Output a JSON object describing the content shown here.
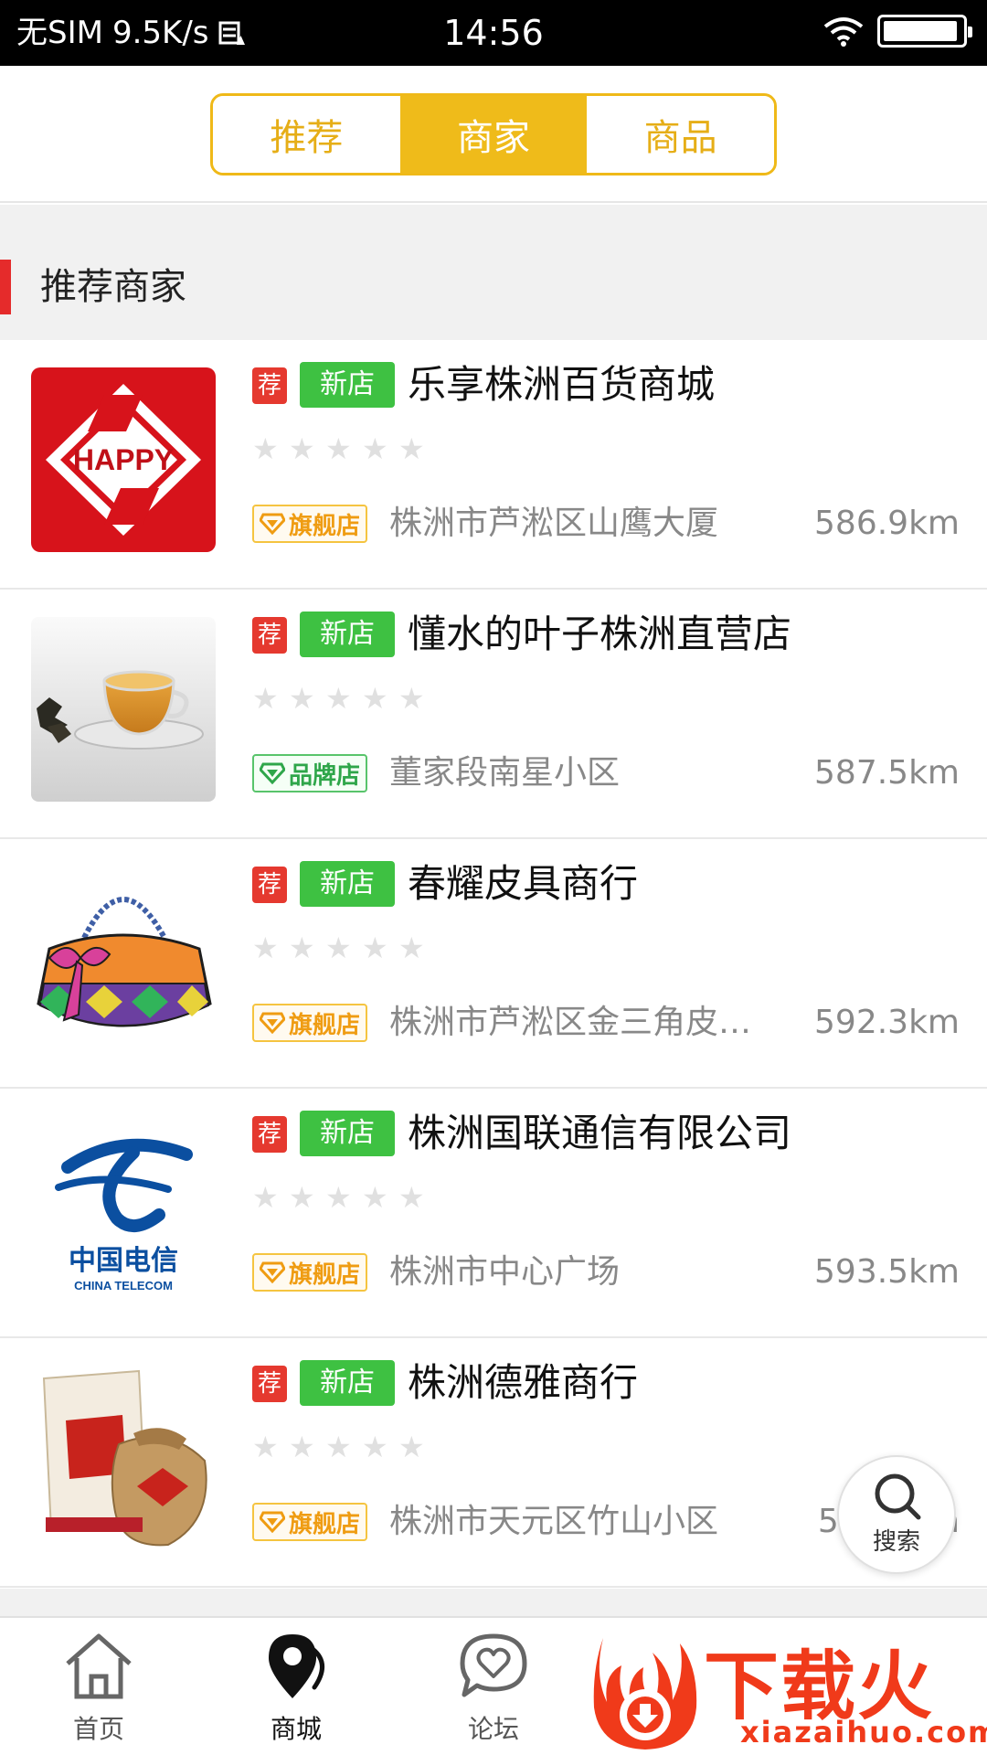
{
  "status_bar": {
    "carrier": "无SIM",
    "net_speed": "9.5K/s",
    "time": "14:56",
    "battery_level": 0.95
  },
  "tabs": [
    {
      "label": "推荐",
      "active": false
    },
    {
      "label": "商家",
      "active": true
    },
    {
      "label": "商品",
      "active": false
    }
  ],
  "section": {
    "title": "推荐商家"
  },
  "shops": [
    {
      "tag_recommend": "荐",
      "tag_new": "新店",
      "name": "乐享株洲百货商城",
      "rating": 0,
      "store_type": "旗舰店",
      "address": "株洲市芦淞区山鹰大厦",
      "distance": "586.9km",
      "thumb": "happy-logo"
    },
    {
      "tag_recommend": "荐",
      "tag_new": "新店",
      "name": "懂水的叶子株洲直营店",
      "rating": 0,
      "store_type": "品牌店",
      "address": "董家段南星小区",
      "distance": "587.5km",
      "thumb": "tea-cup"
    },
    {
      "tag_recommend": "荐",
      "tag_new": "新店",
      "name": "春耀皮具商行",
      "rating": 0,
      "store_type": "旗舰店",
      "address": "株洲市芦淞区金三角皮…",
      "distance": "592.3km",
      "thumb": "handbag"
    },
    {
      "tag_recommend": "荐",
      "tag_new": "新店",
      "name": "株洲国联通信有限公司",
      "rating": 0,
      "store_type": "旗舰店",
      "address": "株洲市中心广场",
      "distance": "593.5km",
      "thumb": "china-telecom-logo"
    },
    {
      "tag_recommend": "荐",
      "tag_new": "新店",
      "name": "株洲德雅商行",
      "rating": 0,
      "store_type": "旗舰店",
      "address": "株洲市天元区竹山小区",
      "distance": "593.?km",
      "thumb": "liquor-bottle"
    }
  ],
  "float_search": {
    "label": "搜索"
  },
  "bottom_nav": [
    {
      "label": "首页",
      "icon": "home-icon"
    },
    {
      "label": "商城",
      "icon": "map-pin-icon"
    },
    {
      "label": "论坛",
      "icon": "chat-heart-icon"
    }
  ],
  "watermark": {
    "text": "下载火",
    "url": "xiazaihuo.com"
  },
  "colors": {
    "accent": "#efbb1a",
    "red_tag": "#e5392f",
    "green_tag": "#3ec142",
    "section_marker": "#e52b2b"
  }
}
